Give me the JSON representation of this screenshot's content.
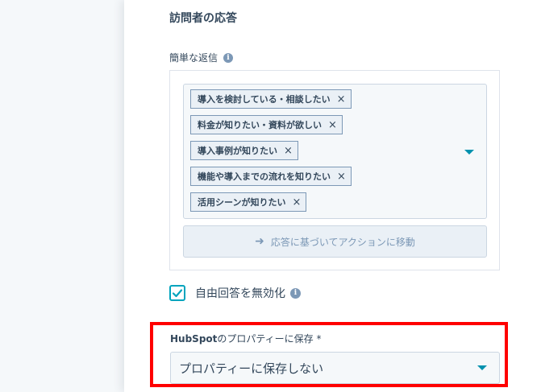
{
  "section": {
    "title": "訪問者の応答"
  },
  "quick_replies": {
    "label": "簡単な返信",
    "info_icon": "i",
    "tags": [
      {
        "label": "導入を検討している・相談したい",
        "remove": "×"
      },
      {
        "label": "料金が知りたい・資料が欲しい",
        "remove": "×"
      },
      {
        "label": "導入事例が知りたい",
        "remove": "×"
      },
      {
        "label": "機能や導入までの流れを知りたい",
        "remove": "×"
      },
      {
        "label": "活用シーンが知りたい",
        "remove": "×"
      }
    ],
    "action_button_arrow": "➜",
    "action_button_label": "応答に基づいてアクションに移動"
  },
  "free_response": {
    "checked": true,
    "label": "自由回答を無効化",
    "info_icon": "i"
  },
  "property": {
    "label_brand": "HubSpot",
    "label_rest": "のプロパティーに保存 *",
    "selected": "プロパティーに保存しない"
  },
  "colors": {
    "accent": "#00a4bd",
    "caret": "#0091ae",
    "highlight": "#ff0000",
    "text": "#33475b"
  }
}
